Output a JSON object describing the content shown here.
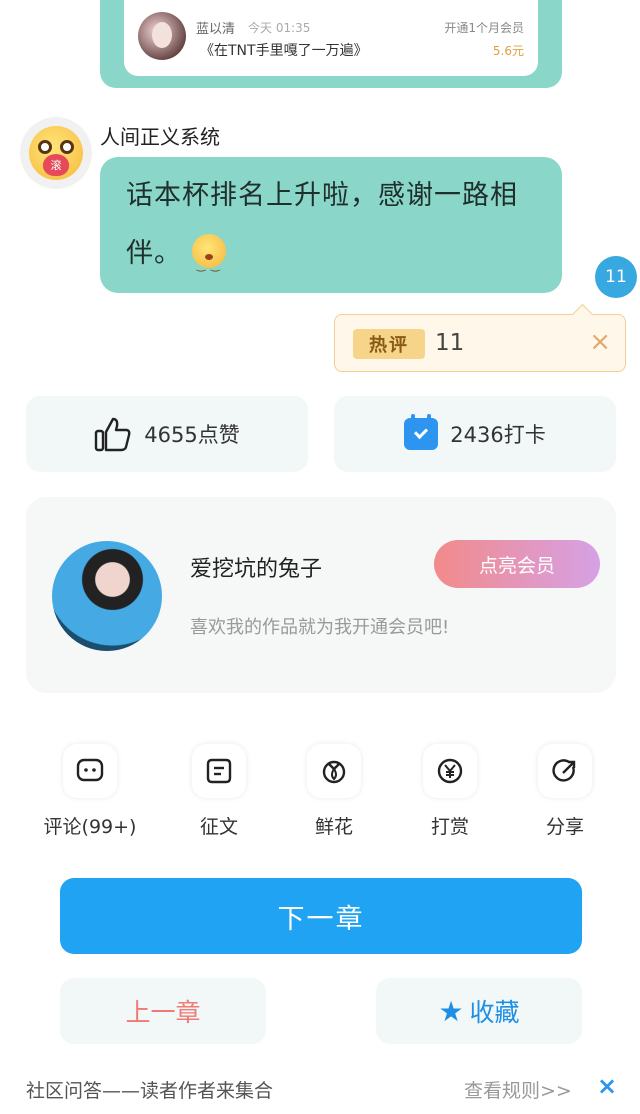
{
  "top_card": {
    "name": "蓝以清",
    "time": "今天 01:35",
    "book": "《在TNT手里嘎了一万遍》",
    "member": "开通1个月会员",
    "price": "5.6元"
  },
  "comment": {
    "author": "人间正义系统",
    "avatar_badge": "滚",
    "text": "话本杯排名上升啦，感谢一路相伴。",
    "count_badge": "11"
  },
  "hot": {
    "tag": "热评",
    "count": "11",
    "close": "×"
  },
  "stats": {
    "likes": "4655点赞",
    "checkins": "2436打卡"
  },
  "author_card": {
    "name": "爱挖坑的兔子",
    "motto": "喜欢我的作品就为我开通会员吧!",
    "member_button": "点亮会员"
  },
  "actions": [
    {
      "label": "评论(99+)",
      "icon": "comment-icon"
    },
    {
      "label": "征文",
      "icon": "document-icon"
    },
    {
      "label": "鲜花",
      "icon": "flower-icon"
    },
    {
      "label": "打赏",
      "icon": "yen-icon"
    },
    {
      "label": "分享",
      "icon": "share-icon"
    }
  ],
  "buttons": {
    "next": "下一章",
    "prev": "上一章",
    "favorite": "收藏"
  },
  "footer": {
    "left": "社区问答——读者作者来集合",
    "right": "查看规则>>",
    "close": "×"
  },
  "colors": {
    "teal": "#8ad6c9",
    "blue": "#1fa3f2",
    "coral": "#f07a74",
    "member_gradient_start": "#f28a8a",
    "member_gradient_end": "#d6a1e6"
  }
}
